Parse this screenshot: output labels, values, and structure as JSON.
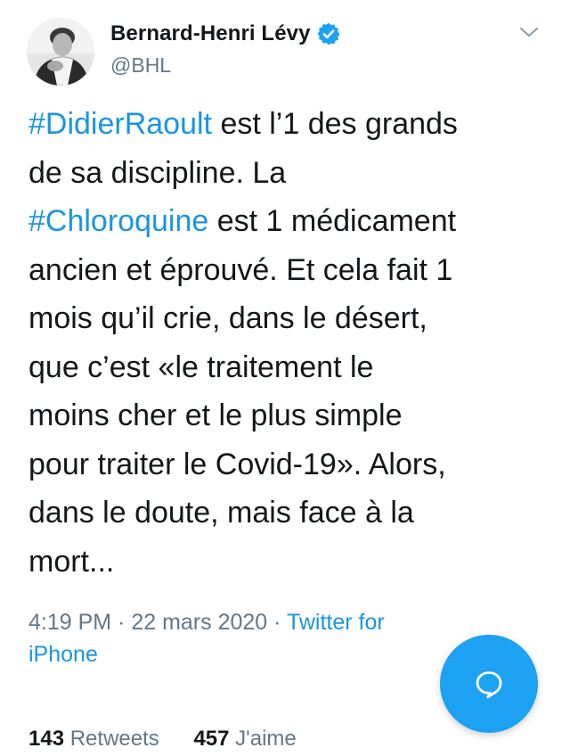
{
  "author": {
    "display_name": "Bernard-Henri Lévy",
    "handle": "@BHL",
    "verified": true
  },
  "tweet": {
    "lines": [
      [
        {
          "text": "#DidierRaoult",
          "hashtag": true
        },
        {
          "text": " est l’1 des grands",
          "hashtag": false
        }
      ],
      [
        {
          "text": "de sa discipline. La",
          "hashtag": false
        }
      ],
      [
        {
          "text": "#Chloroquine",
          "hashtag": true
        },
        {
          "text": " est 1 médicament",
          "hashtag": false
        }
      ],
      [
        {
          "text": "ancien et éprouvé. Et cela fait 1",
          "hashtag": false
        }
      ],
      [
        {
          "text": "mois qu’il crie, dans le désert,",
          "hashtag": false
        }
      ],
      [
        {
          "text": "que c’est «le traitement le",
          "hashtag": false
        }
      ],
      [
        {
          "text": "moins cher et le plus simple",
          "hashtag": false
        }
      ],
      [
        {
          "text": "pour traiter le Covid-19». Alors,",
          "hashtag": false
        }
      ],
      [
        {
          "text": "dans le doute, mais face à la",
          "hashtag": false
        }
      ],
      [
        {
          "text": "mort...",
          "hashtag": false
        }
      ]
    ]
  },
  "meta": {
    "time": "4:19 PM",
    "separator": " · ",
    "date": "22 mars 2020",
    "source": "Twitter for iPhone"
  },
  "stats": {
    "retweets_count": "143",
    "retweets_label": "Retweets",
    "likes_count": "457",
    "likes_label": "J'aime"
  },
  "icons": {
    "verified": "verified-badge-icon",
    "menu": "chevron-down-icon",
    "compose": "reply-bubble-icon"
  },
  "colors": {
    "accent": "#1da1f2",
    "link": "#1b95e0",
    "secondary_text": "#657786",
    "primary_text": "#14171a"
  }
}
